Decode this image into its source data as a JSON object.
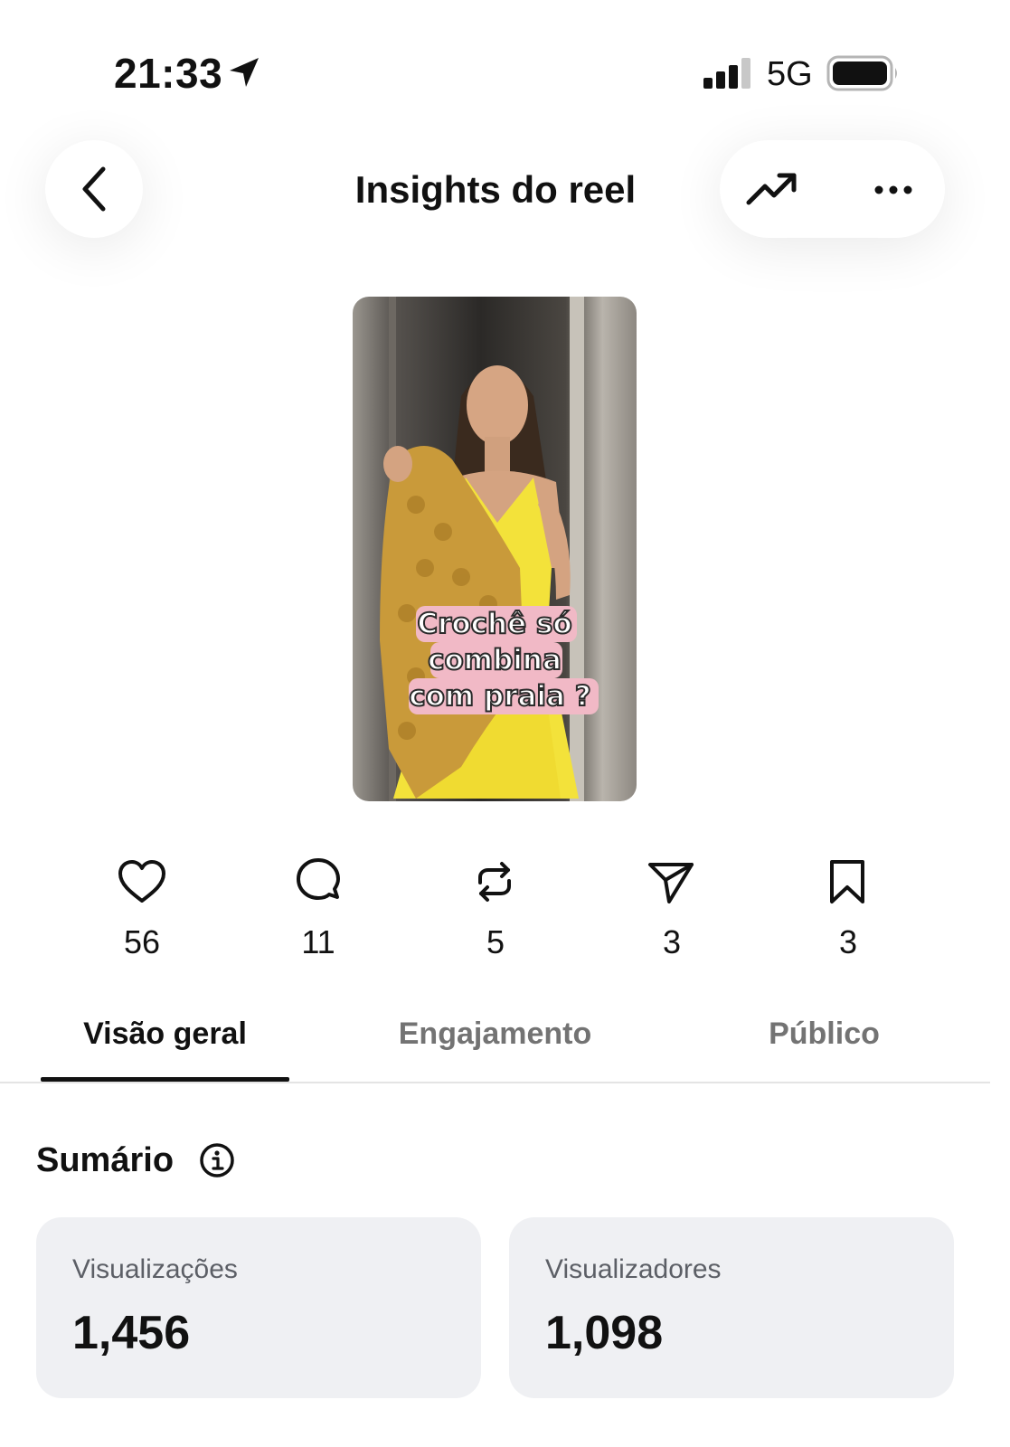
{
  "status_bar": {
    "time": "21:33",
    "network": "5G"
  },
  "header": {
    "title": "Insights do reel"
  },
  "reel": {
    "caption_lines": [
      "Crochê só",
      "combina",
      "com praia ?"
    ]
  },
  "stats": [
    {
      "icon": "heart-icon",
      "value": "56"
    },
    {
      "icon": "comment-icon",
      "value": "11"
    },
    {
      "icon": "repost-icon",
      "value": "5"
    },
    {
      "icon": "share-icon",
      "value": "3"
    },
    {
      "icon": "bookmark-icon",
      "value": "3"
    }
  ],
  "tabs": [
    {
      "label": "Visão geral",
      "active": true
    },
    {
      "label": "Engajamento",
      "active": false
    },
    {
      "label": "Público",
      "active": false
    }
  ],
  "summary": {
    "title": "Sumário",
    "cards": [
      {
        "label": "Visualizações",
        "value": "1,456"
      },
      {
        "label": "Visualizadores",
        "value": "1,098"
      }
    ]
  },
  "colors": {
    "text": "#111111",
    "muted_text": "#737373",
    "card_bg": "#eff0f3",
    "caption_bg": "#f1b9c6",
    "dress_yellow": "#f3e23a",
    "shawl_mustard": "#c99a3a"
  }
}
